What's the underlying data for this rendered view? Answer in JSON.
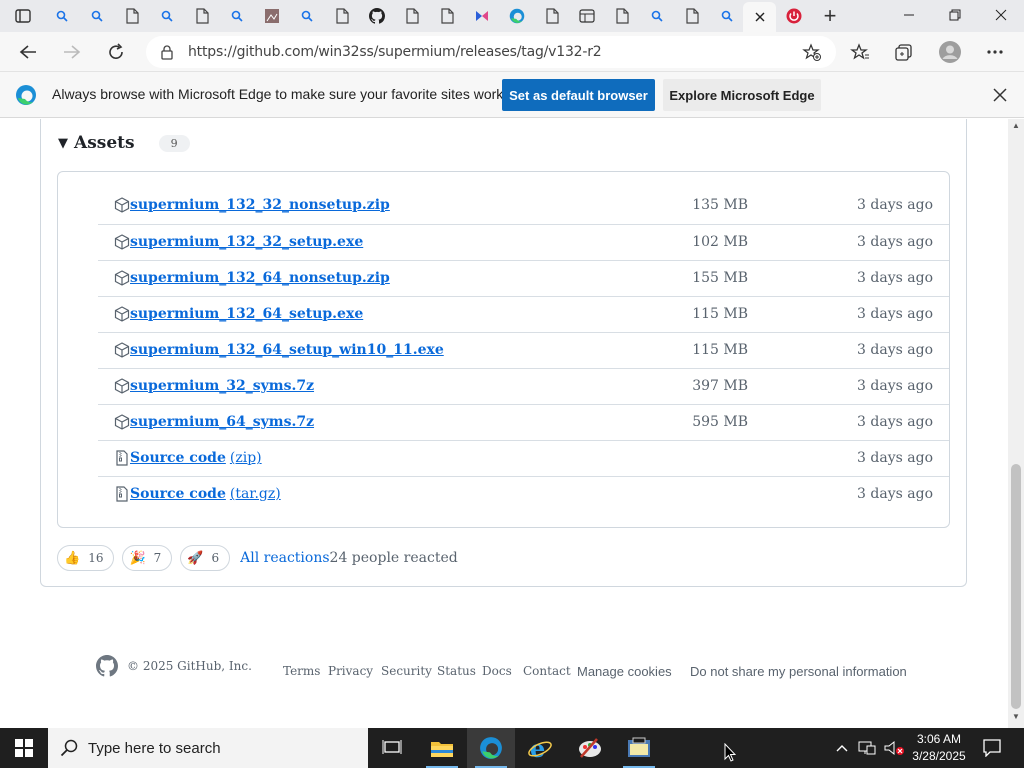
{
  "tabs": [
    {
      "icon": "search-icon"
    },
    {
      "icon": "search-icon"
    },
    {
      "icon": "page-icon"
    },
    {
      "icon": "search-icon"
    },
    {
      "icon": "page-icon"
    },
    {
      "icon": "search-icon"
    },
    {
      "icon": "image-icon"
    },
    {
      "icon": "search-icon"
    },
    {
      "icon": "page-icon"
    },
    {
      "icon": "github-icon"
    },
    {
      "icon": "page-icon"
    },
    {
      "icon": "page-icon"
    },
    {
      "icon": "app-icon"
    },
    {
      "icon": "edge-icon"
    },
    {
      "icon": "page-icon"
    },
    {
      "icon": "grid-icon"
    },
    {
      "icon": "page-icon"
    },
    {
      "icon": "search-icon"
    },
    {
      "icon": "page-icon"
    },
    {
      "icon": "search-icon"
    },
    {
      "icon": "close-icon",
      "active": true
    },
    {
      "icon": "power-icon"
    }
  ],
  "address_bar": {
    "url": "https://github.com/win32ss/supermium/releases/tag/v132-r2"
  },
  "infobar": {
    "message": "Always browse with Microsoft Edge to make sure your favorite sites work",
    "primary_button": "Set as default browser",
    "secondary_button": "Explore Microsoft Edge"
  },
  "assets": {
    "title": "Assets",
    "count": "9",
    "items": [
      {
        "name": "supermium_132_32_nonsetup.zip",
        "suffix": "",
        "size": "135 MB",
        "date": "3 days ago",
        "icon": "package-icon"
      },
      {
        "name": "supermium_132_32_setup.exe",
        "suffix": "",
        "size": "102 MB",
        "date": "3 days ago",
        "icon": "package-icon"
      },
      {
        "name": "supermium_132_64_nonsetup.zip",
        "suffix": "",
        "size": "155 MB",
        "date": "3 days ago",
        "icon": "package-icon"
      },
      {
        "name": "supermium_132_64_setup.exe",
        "suffix": "",
        "size": "115 MB",
        "date": "3 days ago",
        "icon": "package-icon"
      },
      {
        "name": "supermium_132_64_setup_win10_11.exe",
        "suffix": "",
        "size": "115 MB",
        "date": "3 days ago",
        "icon": "package-icon"
      },
      {
        "name": "supermium_32_syms.7z",
        "suffix": "",
        "size": "397 MB",
        "date": "3 days ago",
        "icon": "package-icon"
      },
      {
        "name": "supermium_64_syms.7z",
        "suffix": "",
        "size": "595 MB",
        "date": "3 days ago",
        "icon": "package-icon"
      },
      {
        "name": "Source code",
        "suffix": "(zip)",
        "size": "",
        "date": "3 days ago",
        "icon": "file-zip-icon"
      },
      {
        "name": "Source code",
        "suffix": "(tar.gz)",
        "size": "",
        "date": "3 days ago",
        "icon": "file-zip-icon"
      }
    ]
  },
  "reactions": {
    "items": [
      {
        "emoji": "👍",
        "count": "16",
        "name": "thumbs-up"
      },
      {
        "emoji": "🎉",
        "count": "7",
        "name": "hooray"
      },
      {
        "emoji": "🚀",
        "count": "6",
        "name": "rocket"
      }
    ],
    "all_label": "All reactions",
    "people": "24 people reacted"
  },
  "footer": {
    "copyright": "© 2025 GitHub, Inc.",
    "links": [
      "Terms",
      "Privacy",
      "Security",
      "Status",
      "Docs",
      "Contact",
      "Manage cookies",
      "Do not share my personal information"
    ]
  },
  "taskbar": {
    "search_placeholder": "Type here to search",
    "time": "3:06 AM",
    "date": "3/28/2025"
  },
  "colors": {
    "link": "#0969da",
    "edge_button": "#0f6cbd",
    "taskbar": "#1f1f1f"
  }
}
